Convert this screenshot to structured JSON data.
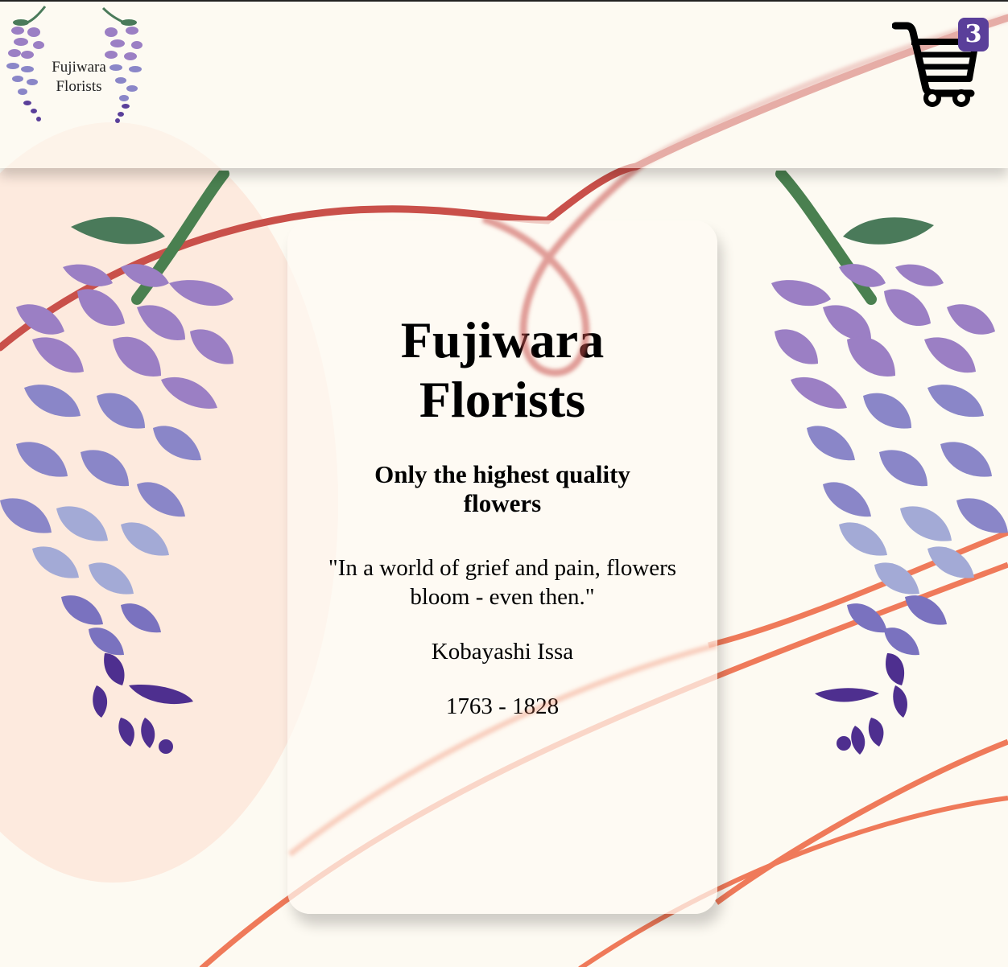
{
  "header": {
    "logo": {
      "line1": "Fujiwara",
      "line2": "Florists"
    },
    "cart": {
      "icon": "shopping-cart-icon",
      "count": "3"
    }
  },
  "hero": {
    "title_line1": "Fujiwara",
    "title_line2": "Florists",
    "tagline": "Only the highest quality flowers",
    "quote": "\"In a world of grief and pain, flowers bloom - even then.\"",
    "author": "Kobayashi Issa",
    "years": "1763 - 1828"
  },
  "decorations": {
    "left_flower": "wisteria-icon",
    "right_flower": "wisteria-icon"
  },
  "colors": {
    "background": "#fdfaf2",
    "accent_purple": "#5a3f9a",
    "vine_red": "#c9504a",
    "vine_orange": "#ef7a5a",
    "sun_peach": "#fde8dc",
    "leaf_green": "#4a7a5a"
  }
}
